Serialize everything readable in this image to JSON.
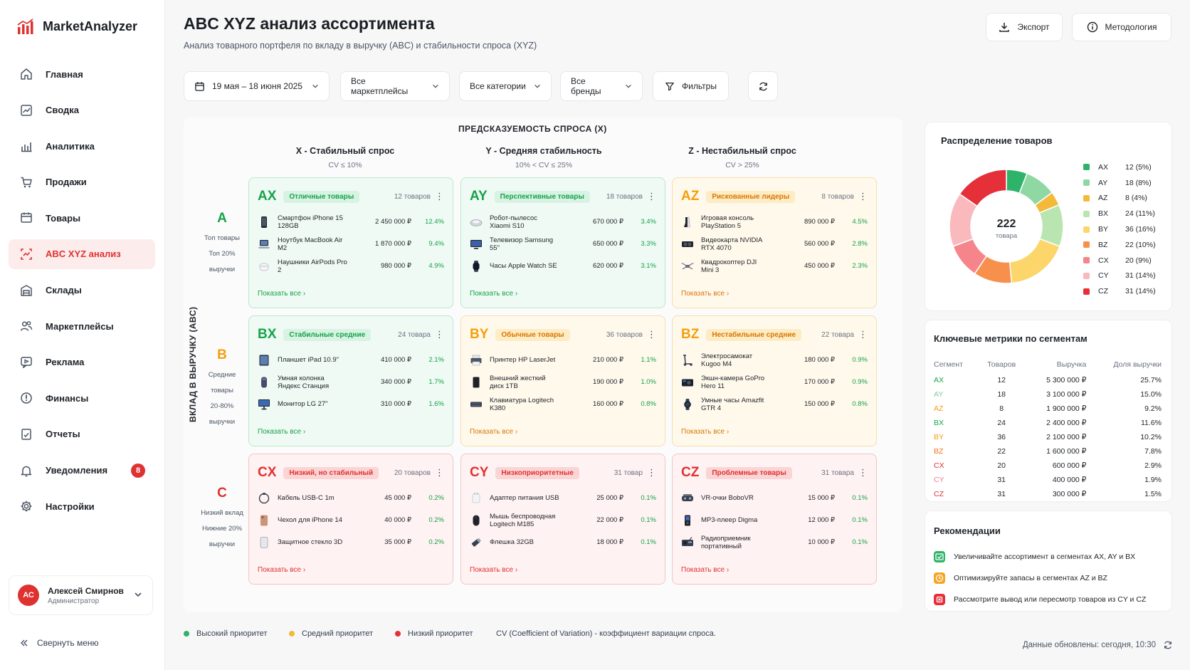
{
  "app": {
    "name": "MarketAnalyzer"
  },
  "nav": [
    {
      "id": "home",
      "label": "Главная",
      "icon": "home-icon"
    },
    {
      "id": "summary",
      "label": "Сводка",
      "icon": "chart-line-icon"
    },
    {
      "id": "analytics",
      "label": "Аналитика",
      "icon": "bar-chart-icon"
    },
    {
      "id": "sales",
      "label": "Продажи",
      "icon": "cart-icon"
    },
    {
      "id": "products",
      "label": "Товары",
      "icon": "box-icon"
    },
    {
      "id": "abcxyz",
      "label": "ABC XYZ анализ",
      "icon": "matrix-icon",
      "active": true
    },
    {
      "id": "warehouses",
      "label": "Склады",
      "icon": "warehouse-icon"
    },
    {
      "id": "marketplaces",
      "label": "Маркетплейсы",
      "icon": "users-icon"
    },
    {
      "id": "ads",
      "label": "Реклама",
      "icon": "ad-icon"
    },
    {
      "id": "finance",
      "label": "Финансы",
      "icon": "coin-icon"
    },
    {
      "id": "reports",
      "label": "Отчеты",
      "icon": "report-icon"
    },
    {
      "id": "notifications",
      "label": "Уведомления",
      "icon": "bell-icon",
      "badge": "8"
    },
    {
      "id": "settings",
      "label": "Настройки",
      "icon": "gear-icon"
    }
  ],
  "user": {
    "initials": "АС",
    "name": "Алексей Смирнов",
    "role": "Администратор"
  },
  "collapse_label": "Свернуть меню",
  "header": {
    "title": "ABC XYZ анализ ассортимента",
    "subtitle": "Анализ товарного портфеля по вкладу в выручку (ABC) и стабильности спроса (XYZ)",
    "export_label": "Экспорт",
    "methodology_label": "Методология"
  },
  "filters": {
    "date_range": "19 мая – 18 июня 2025",
    "marketplaces": "Все маркетплейсы",
    "categories": "Все категории",
    "brands": "Все бренды",
    "filters_label": "Фильтры"
  },
  "matrix": {
    "x_axis_title": "ПРЕДСКАЗУЕМОСТЬ СПРОСА (X)",
    "y_axis_title": "ВКЛАД В ВЫРУЧКУ (ABC)",
    "columns": [
      {
        "title": "X - Стабильный спрос",
        "sub": "CV ≤ 10%"
      },
      {
        "title": "Y - Средняя стабильность",
        "sub": "10% < CV ≤ 25%"
      },
      {
        "title": "Z - Нестабильный спрос",
        "sub": "CV > 25%"
      }
    ],
    "rows": [
      {
        "letter": "A",
        "color": "#16a34a",
        "desc": [
          "Топ товары",
          "Топ 20%",
          "выручки"
        ]
      },
      {
        "letter": "B",
        "color": "#f59e0b",
        "desc": [
          "Средние товары",
          "20-80%",
          "выручки"
        ]
      },
      {
        "letter": "C",
        "color": "#e03131",
        "desc": [
          "Низкий вклад",
          "Нижние 20%",
          "выручки"
        ]
      }
    ],
    "show_all_label": "Показать все",
    "cells": [
      {
        "code": "AX",
        "tag": "Отличные товары",
        "count": "12 товаров",
        "tone": "green",
        "items": [
          {
            "name": "Смартфон iPhone 15 128GB",
            "revenue": "2 450 000 ₽",
            "share": "12.4%",
            "icon": "phone-icon"
          },
          {
            "name": "Ноутбук MacBook Air M2",
            "revenue": "1 870 000 ₽",
            "share": "9.4%",
            "icon": "laptop-icon"
          },
          {
            "name": "Наушники AirPods Pro 2",
            "revenue": "980 000 ₽",
            "share": "4.9%",
            "icon": "earbuds-icon"
          }
        ]
      },
      {
        "code": "AY",
        "tag": "Перспективные товары",
        "count": "18 товаров",
        "tone": "green",
        "items": [
          {
            "name": "Робот-пылесос Xiaomi S10",
            "revenue": "670 000 ₽",
            "share": "3.4%",
            "icon": "vacuum-icon"
          },
          {
            "name": "Телевизор Samsung 55\"",
            "revenue": "650 000 ₽",
            "share": "3.3%",
            "icon": "tv-icon"
          },
          {
            "name": "Часы Apple Watch SE",
            "revenue": "620 000 ₽",
            "share": "3.1%",
            "icon": "watch-icon"
          }
        ]
      },
      {
        "code": "AZ",
        "tag": "Рискованные лидеры",
        "count": "8 товаров",
        "tone": "yellow",
        "items": [
          {
            "name": "Игровая консоль PlayStation 5",
            "revenue": "890 000 ₽",
            "share": "4.5%",
            "icon": "console-icon"
          },
          {
            "name": "Видеокарта NVIDIA RTX 4070",
            "revenue": "560 000 ₽",
            "share": "2.8%",
            "icon": "gpu-icon"
          },
          {
            "name": "Квадрокоптер DJI Mini 3",
            "revenue": "450 000 ₽",
            "share": "2.3%",
            "icon": "drone-icon"
          }
        ]
      },
      {
        "code": "BX",
        "tag": "Стабильные средние",
        "count": "24 товара",
        "tone": "green",
        "items": [
          {
            "name": "Планшет iPad 10.9\"",
            "revenue": "410 000 ₽",
            "share": "2.1%",
            "icon": "tablet-icon"
          },
          {
            "name": "Умная колонка Яндекс Станция",
            "revenue": "340 000 ₽",
            "share": "1.7%",
            "icon": "speaker-icon"
          },
          {
            "name": "Монитор LG 27\"",
            "revenue": "310 000 ₽",
            "share": "1.6%",
            "icon": "monitor-icon"
          }
        ]
      },
      {
        "code": "BY",
        "tag": "Обычные товары",
        "count": "36 товаров",
        "tone": "yellow",
        "items": [
          {
            "name": "Принтер HP LaserJet",
            "revenue": "210 000 ₽",
            "share": "1.1%",
            "icon": "printer-icon"
          },
          {
            "name": "Внешний жесткий диск 1TB",
            "revenue": "190 000 ₽",
            "share": "1.0%",
            "icon": "hdd-icon"
          },
          {
            "name": "Клавиатура Logitech K380",
            "revenue": "160 000 ₽",
            "share": "0.8%",
            "icon": "keyboard-icon"
          }
        ]
      },
      {
        "code": "BZ",
        "tag": "Нестабильные средние",
        "count": "22 товара",
        "tone": "yellow",
        "items": [
          {
            "name": "Электросамокат Kugoo M4",
            "revenue": "180 000 ₽",
            "share": "0.9%",
            "icon": "scooter-icon"
          },
          {
            "name": "Экшн-камера GoPro Hero 11",
            "revenue": "170 000 ₽",
            "share": "0.9%",
            "icon": "camera-icon"
          },
          {
            "name": "Умные часы Amazfit GTR 4",
            "revenue": "150 000 ₽",
            "share": "0.8%",
            "icon": "smartwatch-icon"
          }
        ]
      },
      {
        "code": "CX",
        "tag": "Низкий, но стабильный",
        "count": "20 товаров",
        "tone": "red",
        "items": [
          {
            "name": "Кабель USB-C 1m",
            "revenue": "45 000 ₽",
            "share": "0.2%",
            "icon": "cable-icon"
          },
          {
            "name": "Чехол для iPhone 14",
            "revenue": "40 000 ₽",
            "share": "0.2%",
            "icon": "case-icon"
          },
          {
            "name": "Защитное стекло 3D",
            "revenue": "35 000 ₽",
            "share": "0.2%",
            "icon": "glass-icon"
          }
        ]
      },
      {
        "code": "CY",
        "tag": "Низкоприоритетные",
        "count": "31 товар",
        "tone": "red",
        "items": [
          {
            "name": "Адаптер питания USB",
            "revenue": "25 000 ₽",
            "share": "0.1%",
            "icon": "adapter-icon"
          },
          {
            "name": "Мышь беспроводная Logitech M185",
            "revenue": "22 000 ₽",
            "share": "0.1%",
            "icon": "mouse-icon"
          },
          {
            "name": "Флешка 32GB",
            "revenue": "18 000 ₽",
            "share": "0.1%",
            "icon": "flash-drive-icon"
          }
        ]
      },
      {
        "code": "CZ",
        "tag": "Проблемные товары",
        "count": "31 товара",
        "tone": "red",
        "items": [
          {
            "name": "VR-очки BoboVR",
            "revenue": "15 000 ₽",
            "share": "0.1%",
            "icon": "vr-icon"
          },
          {
            "name": "MP3-плеер Digma",
            "revenue": "12 000 ₽",
            "share": "0.1%",
            "icon": "mp3-icon"
          },
          {
            "name": "Радиоприемник портативный",
            "revenue": "10 000 ₽",
            "share": "0.1%",
            "icon": "radio-icon"
          }
        ]
      }
    ]
  },
  "distribution": {
    "title": "Распределение товаров",
    "total": "222",
    "total_label": "товара",
    "segments": [
      {
        "label": "AX",
        "value": 12,
        "text": "12 (5%)",
        "color": "#2fb36b"
      },
      {
        "label": "AY",
        "value": 18,
        "text": "18 (8%)",
        "color": "#8fd7a3"
      },
      {
        "label": "AZ",
        "value": 8,
        "text": "8 (4%)",
        "color": "#f5b93a"
      },
      {
        "label": "BX",
        "value": 24,
        "text": "24 (11%)",
        "color": "#b9e6b0"
      },
      {
        "label": "BY",
        "value": 36,
        "text": "36 (16%)",
        "color": "#fcd56b"
      },
      {
        "label": "BZ",
        "value": 22,
        "text": "22 (10%)",
        "color": "#f7904d"
      },
      {
        "label": "CX",
        "value": 20,
        "text": "20 (9%)",
        "color": "#f5858a"
      },
      {
        "label": "CY",
        "value": 31,
        "text": "31 (14%)",
        "color": "#f9b9bd"
      },
      {
        "label": "CZ",
        "value": 31,
        "text": "31 (14%)",
        "color": "#e5303a"
      }
    ]
  },
  "metrics": {
    "title": "Ключевые метрики по сегментам",
    "headers": [
      "Сегмент",
      "Товаров",
      "Выручка",
      "Доля выручки"
    ],
    "rows": [
      {
        "seg": "AX",
        "count": "12",
        "revenue": "5 300 000 ₽",
        "share": "25.7%",
        "color": "#16a34a"
      },
      {
        "seg": "AY",
        "count": "18",
        "revenue": "3 100 000 ₽",
        "share": "15.0%",
        "color": "#86c99a"
      },
      {
        "seg": "AZ",
        "count": "8",
        "revenue": "1 900 000 ₽",
        "share": "9.2%",
        "color": "#f59e0b"
      },
      {
        "seg": "BX",
        "count": "24",
        "revenue": "2 400 000 ₽",
        "share": "11.6%",
        "color": "#16a34a"
      },
      {
        "seg": "BY",
        "count": "36",
        "revenue": "2 100 000 ₽",
        "share": "10.2%",
        "color": "#f59e0b"
      },
      {
        "seg": "BZ",
        "count": "22",
        "revenue": "1 600 000 ₽",
        "share": "7.8%",
        "color": "#f97316"
      },
      {
        "seg": "CX",
        "count": "20",
        "revenue": "600 000 ₽",
        "share": "2.9%",
        "color": "#e03131"
      },
      {
        "seg": "CY",
        "count": "31",
        "revenue": "400 000 ₽",
        "share": "1.9%",
        "color": "#f07c84"
      },
      {
        "seg": "CZ",
        "count": "31",
        "revenue": "300 000 ₽",
        "share": "1.5%",
        "color": "#e03131"
      }
    ]
  },
  "recommendations": {
    "title": "Рекомендации",
    "items": [
      {
        "text": "Увеличивайте ассортимент в сегментах AX, AY и BX",
        "color": "#2fb36b"
      },
      {
        "text": "Оптимизируйте запасы в сегментах AZ и BZ",
        "color": "#f5a524"
      },
      {
        "text": "Рассмотрите вывод или пересмотр товаров из CY и CZ",
        "color": "#e5303a"
      }
    ]
  },
  "footer": {
    "high": "Высокий приоритет",
    "medium": "Средний приоритет",
    "low": "Низкий приоритет",
    "cv_note": "CV (Coefficient of Variation) - коэффициент вариации спроса.",
    "updated": "Данные обновлены: сегодня, 10:30",
    "colors": {
      "high": "#2fb36b",
      "medium": "#f5b93a",
      "low": "#e5303a"
    }
  }
}
